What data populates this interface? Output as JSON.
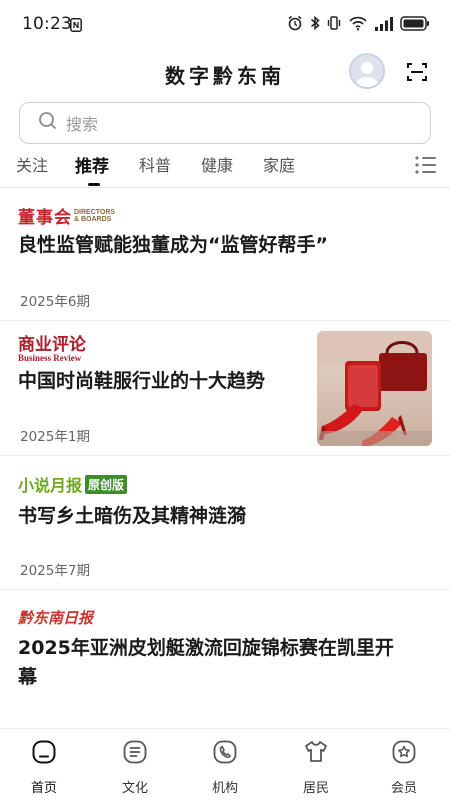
{
  "status_bar": {
    "time": "10:23",
    "icons": [
      "nfc-icon",
      "alarm-icon",
      "bluetooth-icon",
      "vibrate-icon",
      "wifi-icon",
      "signal-icon",
      "battery-icon"
    ]
  },
  "header": {
    "title": "数字黔东南",
    "avatar_icon": "user-avatar-icon",
    "scan_icon": "scan-icon"
  },
  "search": {
    "placeholder": "搜索",
    "icon": "search-icon"
  },
  "tabs": [
    {
      "label": "关注",
      "active": false
    },
    {
      "label": "推荐",
      "active": true
    },
    {
      "label": "科普",
      "active": false
    },
    {
      "label": "健康",
      "active": false
    },
    {
      "label": "家庭",
      "active": false
    }
  ],
  "tab_menu_icon": "list-menu-icon",
  "articles": [
    {
      "source_main": "董事会",
      "source_en": "DIRECTORS & BOARDS",
      "title": "良性监管赋能独董成为“监管好帮手”",
      "issue": "2025年6期"
    },
    {
      "source_main": "商业评论",
      "source_en": "Business Review",
      "title": "中国时尚鞋服行业的十大趋势",
      "issue": "2025年1期",
      "thumbnail": "red-shoes-and-handbag-image"
    },
    {
      "source_main": "小说月报",
      "source_badge": "原创版",
      "title": "书写乡土暗伤及其精神涟漪",
      "issue": "2025年7期"
    },
    {
      "source_main": "黔东南日报",
      "title_line1": "2025年亚洲皮划艇激流回旋锦标赛在凯里开",
      "title_line2": "幕"
    }
  ],
  "bottom_nav": [
    {
      "label": "首页",
      "icon": "home-icon",
      "active": true
    },
    {
      "label": "文化",
      "icon": "document-icon",
      "active": false
    },
    {
      "label": "机构",
      "icon": "phone-icon",
      "active": false
    },
    {
      "label": "居民",
      "icon": "shirt-icon",
      "active": false
    },
    {
      "label": "会员",
      "icon": "star-badge-icon",
      "active": false
    }
  ],
  "colors": {
    "accent_red": "#c4262d",
    "green": "#6fa822",
    "text_primary": "#1a1a1a",
    "text_secondary": "#666666"
  }
}
